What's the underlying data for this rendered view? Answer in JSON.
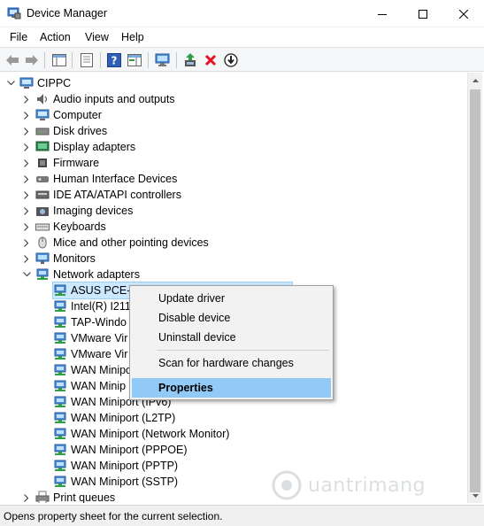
{
  "window": {
    "title": "Device Manager"
  },
  "menu": [
    "File",
    "Action",
    "View",
    "Help"
  ],
  "tree": {
    "root": "CIPPC",
    "categories": [
      "Audio inputs and outputs",
      "Computer",
      "Disk drives",
      "Display adapters",
      "Firmware",
      "Human Interface Devices",
      "IDE ATA/ATAPI controllers",
      "Imaging devices",
      "Keyboards",
      "Mice and other pointing devices",
      "Monitors",
      "Network adapters"
    ],
    "network_devices": [
      "ASUS PCE-A",
      "Intel(R) I211",
      "TAP-Windo",
      "VMware Vir",
      "VMware Vir",
      "WAN Minipo",
      "WAN Minip",
      "WAN Miniport (IPv6)",
      "WAN Miniport (L2TP)",
      "WAN Miniport (Network Monitor)",
      "WAN Miniport (PPPOE)",
      "WAN Miniport (PPTP)",
      "WAN Miniport (SSTP)"
    ],
    "after": "Print queues"
  },
  "context_menu": {
    "items": [
      "Update driver",
      "Disable device",
      "Uninstall device"
    ],
    "scan": "Scan for hardware changes",
    "properties": "Properties"
  },
  "status": "Opens property sheet for the current selection.",
  "watermark": "uantrimang",
  "colors": {
    "selection": "#cce8ff",
    "menu_highlight": "#91c9f7",
    "delete_red": "#e81123",
    "green": "#2ea043"
  }
}
